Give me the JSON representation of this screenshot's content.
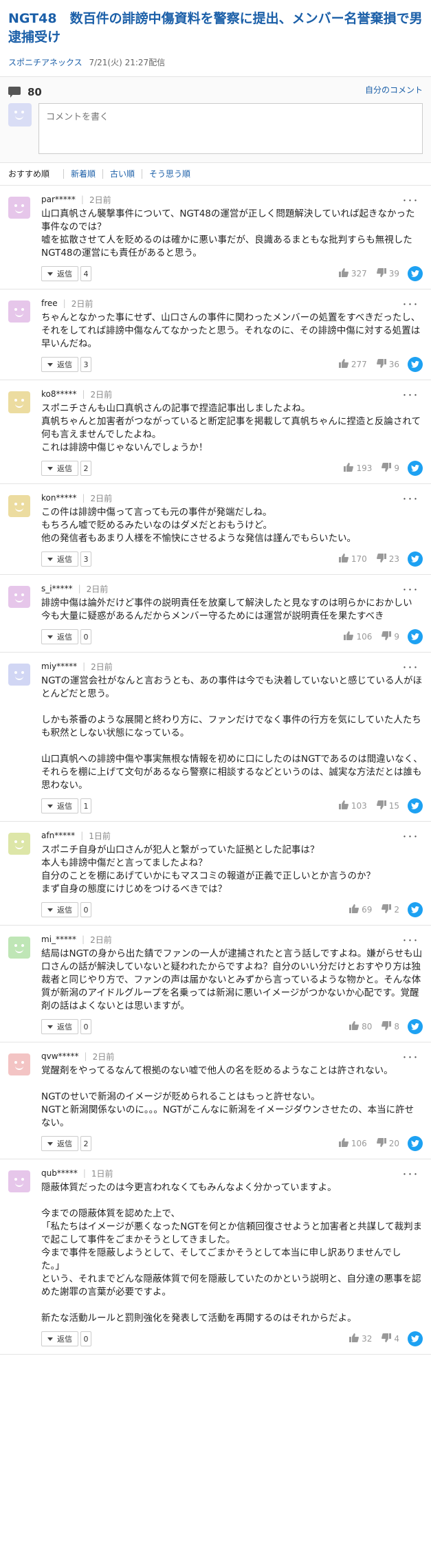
{
  "article": {
    "title": "NGT48　数百件の誹謗中傷資料を警察に提出、メンバー名誉棄損で男逮捕受け",
    "source": "スポニチアネックス",
    "date": "7/21(火) 21:27配信"
  },
  "comments_header": {
    "count": "80",
    "my_comments_label": "自分のコメント",
    "input_placeholder": "コメントを書く"
  },
  "sort": [
    "おすすめ順",
    "新着順",
    "古い順",
    "そう思う順"
  ],
  "ui": {
    "reply_label": "返信",
    "more_label": "･･･"
  },
  "colors": {
    "link": "#1b5fa8",
    "twitter": "#1da1f2"
  },
  "comments": [
    {
      "user": "par*****",
      "time": "2日前",
      "avatar_color": "#e6c6ea",
      "text": "山口真帆さん襲撃事件について、NGT48の運営が正しく問題解決していれば起きなかった事件なのでは？\n嘘を拡散させて人を貶めるのは確かに悪い事だが、良識あるまともな批判すらも無視したNGT48の運営にも責任があると思う。",
      "replies": "4",
      "agree": "327",
      "disagree": "39"
    },
    {
      "user": "free",
      "time": "2日前",
      "avatar_color": "#e6c6ea",
      "text": "ちゃんとなかった事にせず、山口さんの事件に関わったメンバーの処置をすべきだったし、それをしてれば誹謗中傷なんてなかったと思う。それなのに、その誹謗中傷に対する処置は早いんだね。",
      "replies": "3",
      "agree": "277",
      "disagree": "36"
    },
    {
      "user": "ko8*****",
      "time": "2日前",
      "avatar_color": "#ecdca0",
      "text": "スポニチさんも山口真帆さんの記事で捏造記事出しましたよね。\n真帆ちゃんと加害者がつながっていると断定記事を掲載して真帆ちゃんに捏造と反論されて\n何も言えませんでしたよね。\nこれは誹謗中傷じゃないんでしょうか！",
      "replies": "2",
      "agree": "193",
      "disagree": "9"
    },
    {
      "user": "kon*****",
      "time": "2日前",
      "avatar_color": "#ecdca0",
      "text": "この件は誹謗中傷って言っても元の事件が発端だしね。\nもちろん嘘で貶めるみたいなのはダメだとおもうけど。\n他の発信者もあまり人様を不愉快にさせるような発信は謹んでもらいたい。",
      "replies": "3",
      "agree": "170",
      "disagree": "23"
    },
    {
      "user": "s_i*****",
      "time": "2日前",
      "avatar_color": "#e6c6ea",
      "text": "誹謗中傷は論外だけど事件の説明責任を放棄して解決したと見なすのは明らかにおかしい\n今も大量に疑惑があるんだからメンバー守るためには運営が説明責任を果たすべき",
      "replies": "0",
      "agree": "106",
      "disagree": "9"
    },
    {
      "user": "miy*****",
      "time": "2日前",
      "avatar_color": "#d1d6f4",
      "text": "NGTの運営会社がなんと言おうとも、あの事件は今でも決着していないと感じている人がほとんどだと思う。\n\nしかも茶番のような展開と終わり方に、ファンだけでなく事件の行方を気にしていた人たちも釈然としない状態になっている。\n\n山口真帆への誹謗中傷や事実無根な情報を初めに口にしたのはNGTであるのは間違いなく、それらを棚に上げて文句があるなら警察に相談するなどというのは、誠実な方法だとは誰も思わない。",
      "replies": "1",
      "agree": "103",
      "disagree": "15"
    },
    {
      "user": "afn*****",
      "time": "1日前",
      "avatar_color": "#dde6a8",
      "text": "スポニチ自身が山口さんが犯人と繋がっていた証拠とした記事は？\n本人も誹謗中傷だと言ってましたよね？\n自分のことを棚にあげていかにもマスコミの報道が正義で正しいとか言うのか？\nまず自身の態度にけじめをつけるべきでは？",
      "replies": "0",
      "agree": "69",
      "disagree": "2"
    },
    {
      "user": "mi_*****",
      "time": "2日前",
      "avatar_color": "#bfe6b6",
      "text": "結局はNGTの身から出た錆でファンの一人が逮捕されたと言う話しですよね。嫌がらせも山口さんの話が解決していないと疑われたからですよね？自分のいい分だけとおすやり方は独裁者と同じやり方で、ファンの声は届かないとみずから言っているような物かと。そんな体質が新潟のアイドルグループを名乗っては新潟に悪いイメージがつかないか心配です。覚醒剤の話はよくないとは思いますが。",
      "replies": "0",
      "agree": "80",
      "disagree": "8"
    },
    {
      "user": "qvw*****",
      "time": "2日前",
      "avatar_color": "#f3c4c4",
      "text": "覚醒剤をやってるなんて根拠のない嘘で他人の名を貶めるようなことは許されない。\n\nNGTのせいで新潟のイメージが貶められることはもっと許せない。\nNGTと新潟関係ないのに。。。NGTがこんなに新潟をイメージダウンさせたの、本当に許せない。",
      "replies": "2",
      "agree": "106",
      "disagree": "20"
    },
    {
      "user": "qub*****",
      "time": "1日前",
      "avatar_color": "#e6c6ea",
      "text": "隠蔽体質だったのは今更言われなくてもみんなよく分かっていますよ。\n\n今までの隠蔽体質を認めた上で、\n「私たちはイメージが悪くなったNGTを何とか信頼回復させようと加害者と共謀して裁判まで起こして事件をごまかそうとしてきました。\n今まで事件を隠蔽しようとして、そしてごまかそうとして本当に申し訳ありませんでした。」\nという、それまでどんな隠蔽体質で何を隠蔽していたのかという説明と、自分達の悪事を認めた謝罪の言葉が必要ですよ。\n\n新たな活動ルールと罰則強化を発表して活動を再開するのはそれからだよ。",
      "replies": "0",
      "agree": "32",
      "disagree": "4"
    }
  ]
}
